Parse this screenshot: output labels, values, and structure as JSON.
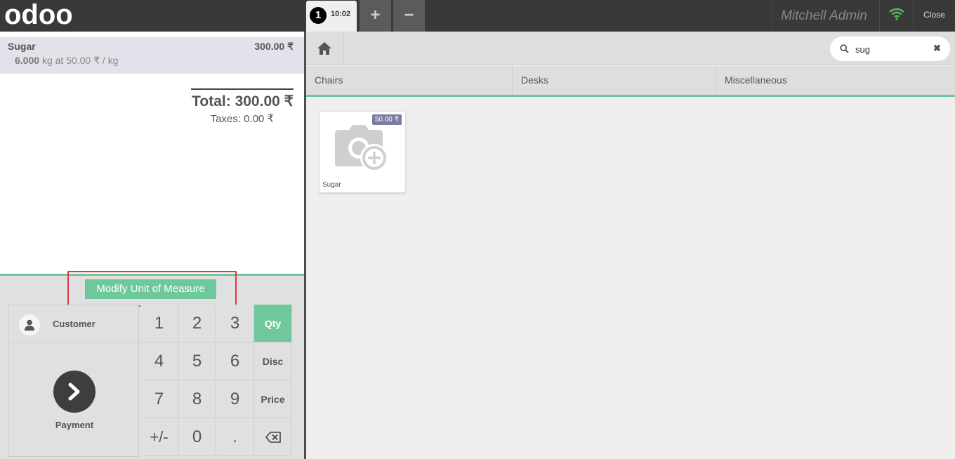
{
  "brand": {
    "logo_text": "odoo"
  },
  "topbar": {
    "order_number": "1",
    "order_time": "10:02",
    "add_order": "+",
    "remove_order": "−",
    "username": "Mitchell Admin",
    "close_label": "Close",
    "wifi_color": "#5cb85c"
  },
  "order": {
    "lines": [
      {
        "product": "Sugar",
        "price": "300.00 ₹",
        "quantity": "6.000",
        "unit_info": "kg at 50.00 ₹ / kg"
      }
    ],
    "total": "Total: 300.00 ₹",
    "taxes": "Taxes: 0.00 ₹"
  },
  "controls": {
    "modify_uom": "Modify Unit of Measure",
    "customer": "Customer",
    "payment": "Payment"
  },
  "numpad": {
    "keys": [
      "1",
      "2",
      "3",
      "4",
      "5",
      "6",
      "7",
      "8",
      "9",
      "+/-",
      "0",
      "."
    ],
    "modes": [
      "Qty",
      "Disc",
      "Price"
    ],
    "active_mode": "Qty"
  },
  "search": {
    "value": "sug",
    "clear": "✖"
  },
  "categories": [
    "Chairs",
    "Desks",
    "Miscellaneous"
  ],
  "products": [
    {
      "name": "Sugar",
      "price": "50.00 ₹",
      "icon": "camera-add-icon"
    }
  ],
  "colors": {
    "accent": "#6ec89b",
    "highlight": "#e8334a",
    "topbar": "#393939",
    "price_tag": "#7a7ba1"
  }
}
